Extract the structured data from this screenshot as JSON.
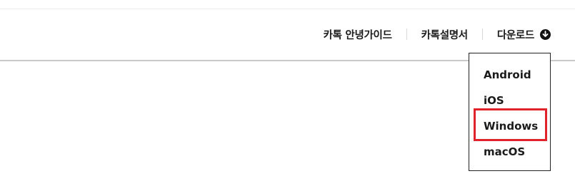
{
  "header": {
    "nav": {
      "guide_label": "카톡 안녕가이드",
      "manual_label": "카톡설명서",
      "download_label": "다운로드",
      "download_icon": "arrow-down-circle-icon"
    }
  },
  "download_menu": {
    "items": [
      {
        "label": "Android"
      },
      {
        "label": "iOS"
      },
      {
        "label": "Windows"
      },
      {
        "label": "macOS"
      }
    ],
    "highlighted": "Windows",
    "highlight_color": "#e0222a"
  }
}
